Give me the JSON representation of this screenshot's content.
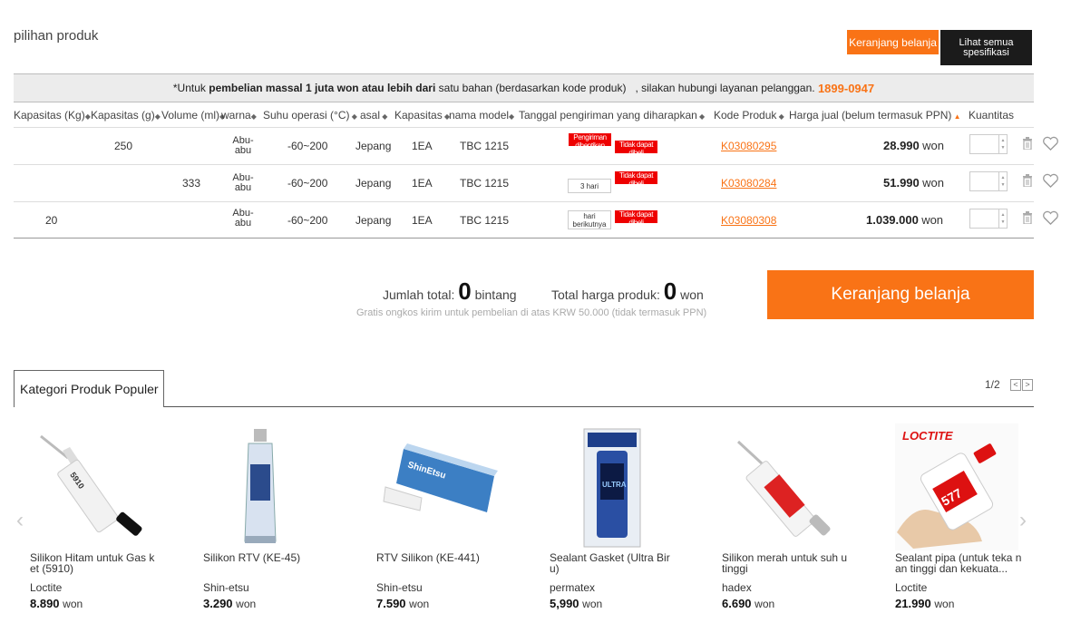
{
  "page": {
    "title": "pilihan produk"
  },
  "buttons": {
    "cart_top": "Keranjang belanja",
    "spec_line1": "Lihat semua",
    "spec_line2": "spesifikasi",
    "cart_big": "Keranjang belanja"
  },
  "notice": {
    "prefix": "*Untuk ",
    "bold": "pembelian massal 1 juta won atau lebih dari",
    "middle": " satu bahan (berdasarkan kode produk)   , silakan hubungi layanan pelanggan. ",
    "phone": "1899-0947"
  },
  "columns": [
    "Kapasitas (Kg)",
    "Kapasitas (g)",
    "Volume (ml)",
    "warna",
    "Suhu operasi (°C)",
    "asal",
    "Kapasitas",
    "nama model",
    "Tanggal pengiriman yang diharapkan",
    "Kode Produk",
    "Harga jual (belum termasuk PPN)",
    "Kuantitas"
  ],
  "rows": [
    {
      "kg": "250",
      "g": "",
      "ml": "",
      "color1": "Abu-",
      "color2": "abu",
      "temp": "-60~200",
      "origin": "Jepang",
      "capacity": "1EA",
      "model": "TBC 1215",
      "ship_a": "Pengiriman",
      "ship_a2": "dihentikan",
      "ship_b": "Tidak dapat",
      "ship_b2": "dibeli",
      "code": "K03080295",
      "price": "28.990",
      "currency": "won"
    },
    {
      "kg": "",
      "g": "333",
      "ml": "",
      "color1": "Abu-",
      "color2": "abu",
      "temp": "-60~200",
      "origin": "Jepang",
      "capacity": "1EA",
      "model": "TBC 1215",
      "ship_a": "3 hari",
      "ship_a2": "",
      "ship_b": "Tidak dapat",
      "ship_b2": "dibeli",
      "code": "K03080284",
      "price": "51.990",
      "currency": "won"
    },
    {
      "kg": "20",
      "g": "",
      "ml": "",
      "color1": "Abu-",
      "color2": "abu",
      "temp": "-60~200",
      "origin": "Jepang",
      "capacity": "1EA",
      "model": "TBC 1215",
      "ship_a": "hari",
      "ship_a2": "berikutnya",
      "ship_b": "Tidak dapat",
      "ship_b2": "dibeli",
      "code": "K03080308",
      "price": "1.039.000",
      "currency": "won"
    }
  ],
  "summary": {
    "total_label": "Jumlah total:",
    "total_value": "0",
    "total_unit": "bintang",
    "price_label": "Total harga produk:",
    "price_value": "0",
    "price_unit": "won",
    "ship_note": "Gratis ongkos kirim untuk pembelian di atas KRW 50.000 (tidak termasuk PPN)"
  },
  "popular": {
    "tab_label": "Kategori Produk Populer",
    "pager": "1/2",
    "products": [
      {
        "name": "Silikon Hitam untuk Gas ket (5910)",
        "brand": "Loctite",
        "price": "8.890",
        "currency": "won",
        "icon": "silicone-tube-black"
      },
      {
        "name": "Silikon RTV (KE-45)",
        "brand": "Shin-etsu",
        "price": "3.290",
        "currency": "won",
        "icon": "tube-blue"
      },
      {
        "name": "RTV Silikon (KE-441)",
        "brand": "Shin-etsu",
        "price": "7.590",
        "currency": "won",
        "icon": "tube-blue-box"
      },
      {
        "name": "Sealant Gasket (Ultra Bir u)",
        "brand": "permatex",
        "price": "5,990",
        "currency": "won",
        "icon": "gasket-package"
      },
      {
        "name": "Silikon merah untuk suh u tinggi",
        "brand": "hadex",
        "price": "6.690",
        "currency": "won",
        "icon": "silicone-tube-red"
      },
      {
        "name": "Sealant pipa (untuk teka nan tinggi dan kekuata...",
        "brand": "Loctite",
        "price": "21.990",
        "currency": "won",
        "icon": "loctite-bottle",
        "logo": "LOCTITE"
      }
    ]
  },
  "colors": {
    "accent": "#f97316",
    "dark": "#1b1b1b",
    "red_badge": "#ee0000"
  }
}
